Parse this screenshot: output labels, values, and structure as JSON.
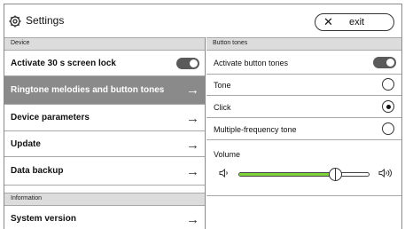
{
  "header": {
    "title": "Settings",
    "icon": "gear-icon",
    "exit_label": "exit",
    "exit_icon": "close-icon"
  },
  "left_panel": {
    "section_device": "Device",
    "items": [
      {
        "label": "Activate 30 s screen lock",
        "control": "toggle",
        "toggle_on": true
      },
      {
        "label": "Ringtone melodies and button tones",
        "control": "arrow",
        "selected": true
      },
      {
        "label": "Device parameters",
        "control": "arrow"
      },
      {
        "label": "Update",
        "control": "arrow"
      },
      {
        "label": "Data backup",
        "control": "arrow"
      }
    ],
    "section_information": "Information",
    "info_items": [
      {
        "label": "System version",
        "control": "arrow"
      }
    ]
  },
  "right_panel": {
    "section_title": "Button tones",
    "activate_label": "Activate button tones",
    "activate_on": true,
    "options": [
      {
        "label": "Tone",
        "selected": false
      },
      {
        "label": "Click",
        "selected": true
      },
      {
        "label": "Multiple-frequency tone",
        "selected": false
      }
    ],
    "volume_label": "Volume",
    "volume_level": 0.74
  },
  "colors": {
    "selected_row": "#8a8a8a",
    "section_header": "#dcdcdc",
    "toggle": "#5a5a5a",
    "volume_fill": "#7fd437"
  }
}
